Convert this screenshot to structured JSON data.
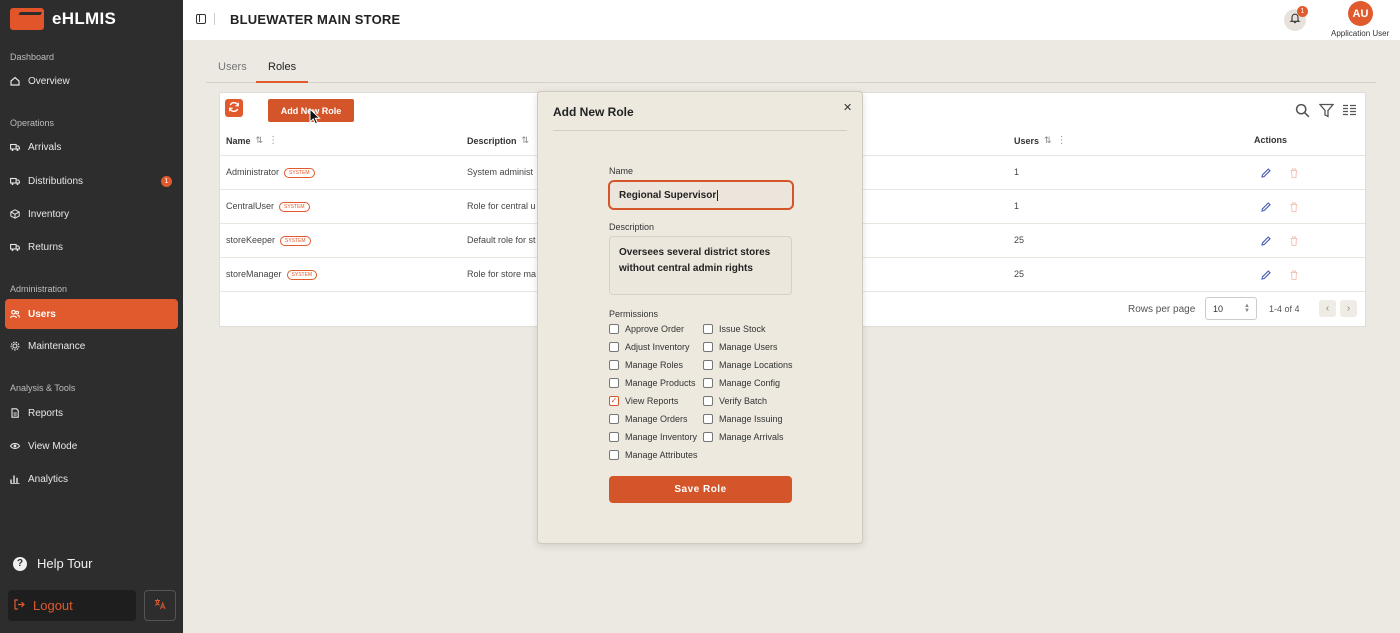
{
  "app": {
    "name": "eHLMIS"
  },
  "sidebar": {
    "sections": [
      {
        "label": "Dashboard"
      },
      {
        "label": "Operations"
      },
      {
        "label": "Administration"
      },
      {
        "label": "Analysis & Tools"
      }
    ],
    "items": [
      {
        "label": "Overview",
        "icon": "home-icon"
      },
      {
        "label": "Arrivals",
        "icon": "truck-icon"
      },
      {
        "label": "Distributions",
        "icon": "truck-icon",
        "badge": "1"
      },
      {
        "label": "Inventory",
        "icon": "box-icon"
      },
      {
        "label": "Returns",
        "icon": "truck-icon"
      },
      {
        "label": "Users",
        "icon": "users-icon",
        "active": true
      },
      {
        "label": "Maintenance",
        "icon": "gear-icon"
      },
      {
        "label": "Reports",
        "icon": "file-icon"
      },
      {
        "label": "View Mode",
        "icon": "eye-icon"
      },
      {
        "label": "Analytics",
        "icon": "bar-chart-icon"
      }
    ],
    "help_tour": "Help Tour",
    "logout": "Logout",
    "language_icon": "translate-icon"
  },
  "topbar": {
    "store_title": "BLUEWATER MAIN STORE",
    "notification_count": "1",
    "avatar_initials": "AU",
    "user_name": "Application User"
  },
  "tabs": [
    {
      "label": "Users"
    },
    {
      "label": "Roles",
      "active": true
    }
  ],
  "table": {
    "add_button": "Add New Role",
    "columns": {
      "name": "Name",
      "description": "Description",
      "users": "Users",
      "actions": "Actions"
    },
    "system_badge": "SYSTEM",
    "rows": [
      {
        "name": "Administrator",
        "description": "System administ",
        "users": "1"
      },
      {
        "name": "CentralUser",
        "description": "Role for central u",
        "users": "1"
      },
      {
        "name": "storeKeeper",
        "description": "Default role for st",
        "users": "25"
      },
      {
        "name": "storeManager",
        "description": "Role for store ma",
        "users": "25"
      }
    ],
    "rows_per_page_label": "Rows per page",
    "rows_per_page_value": "10",
    "page_info": "1-4 of 4"
  },
  "modal": {
    "title": "Add New Role",
    "name_label": "Name",
    "name_value": "Regional Supervisor",
    "description_label": "Description",
    "description_value": "Oversees several district stores without central admin rights",
    "permissions_label": "Permissions",
    "permissions_left": [
      {
        "label": "Approve Order",
        "checked": false
      },
      {
        "label": "Adjust Inventory",
        "checked": false
      },
      {
        "label": "Manage Roles",
        "checked": false
      },
      {
        "label": "Manage Products",
        "checked": false
      },
      {
        "label": "View Reports",
        "checked": true
      },
      {
        "label": "Manage Orders",
        "checked": false
      },
      {
        "label": "Manage Inventory",
        "checked": false
      },
      {
        "label": "Manage Attributes",
        "checked": false
      }
    ],
    "permissions_right": [
      {
        "label": "Issue Stock",
        "checked": false
      },
      {
        "label": "Manage Users",
        "checked": false
      },
      {
        "label": "Manage Locations",
        "checked": false
      },
      {
        "label": "Manage Config",
        "checked": false
      },
      {
        "label": "Verify Batch",
        "checked": false
      },
      {
        "label": "Manage Issuing",
        "checked": false
      },
      {
        "label": "Manage Arrivals",
        "checked": false
      }
    ],
    "save_button": "Save Role"
  },
  "colors": {
    "accent": "#e05a2d",
    "sidebar_bg": "#2d2d2d",
    "page_bg": "#ece9e2"
  }
}
